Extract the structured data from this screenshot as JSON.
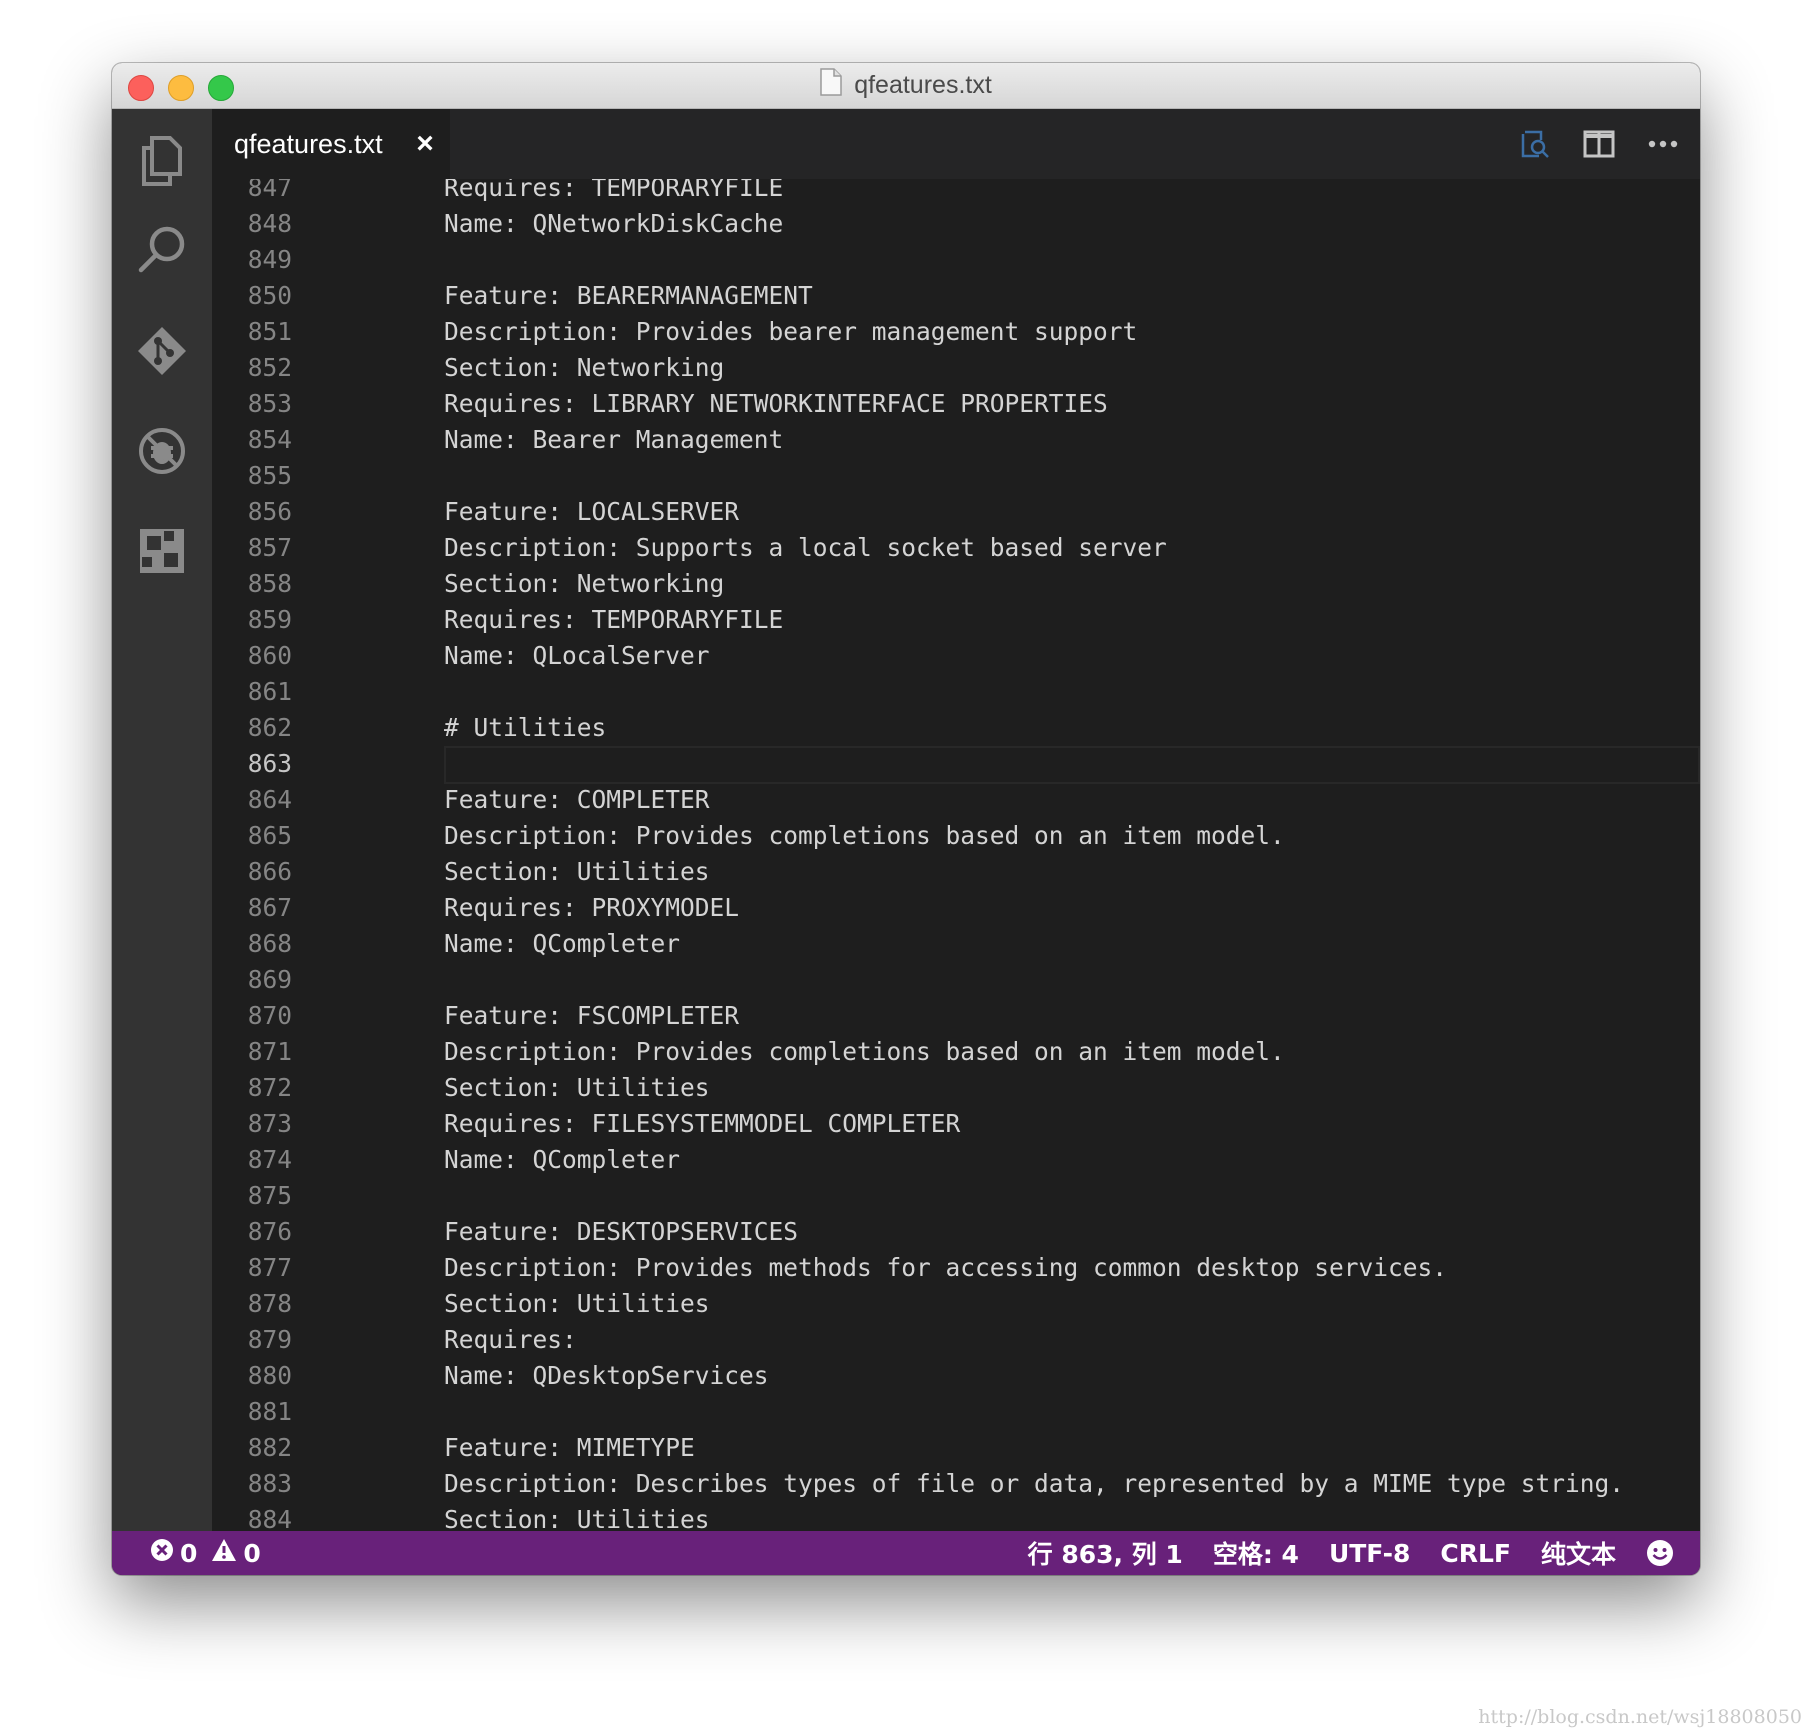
{
  "window": {
    "title": "qfeatures.txt"
  },
  "activity_bar": {
    "items": [
      "explorer-icon",
      "search-icon",
      "source-control-icon",
      "debug-icon",
      "extensions-icon"
    ]
  },
  "tabs": [
    {
      "label": "qfeatures.txt",
      "close_glyph": "×"
    }
  ],
  "editor": {
    "current_line": 863,
    "lines": [
      {
        "n": "847",
        "text": "Requires: TEMPORARYFILE"
      },
      {
        "n": "848",
        "text": "Name: QNetworkDiskCache"
      },
      {
        "n": "849",
        "text": ""
      },
      {
        "n": "850",
        "text": "Feature: BEARERMANAGEMENT"
      },
      {
        "n": "851",
        "text": "Description: Provides bearer management support"
      },
      {
        "n": "852",
        "text": "Section: Networking"
      },
      {
        "n": "853",
        "text": "Requires: LIBRARY NETWORKINTERFACE PROPERTIES"
      },
      {
        "n": "854",
        "text": "Name: Bearer Management"
      },
      {
        "n": "855",
        "text": ""
      },
      {
        "n": "856",
        "text": "Feature: LOCALSERVER"
      },
      {
        "n": "857",
        "text": "Description: Supports a local socket based server"
      },
      {
        "n": "858",
        "text": "Section: Networking"
      },
      {
        "n": "859",
        "text": "Requires: TEMPORARYFILE"
      },
      {
        "n": "860",
        "text": "Name: QLocalServer"
      },
      {
        "n": "861",
        "text": ""
      },
      {
        "n": "862",
        "text": "# Utilities"
      },
      {
        "n": "863",
        "text": ""
      },
      {
        "n": "864",
        "text": "Feature: COMPLETER"
      },
      {
        "n": "865",
        "text": "Description: Provides completions based on an item model."
      },
      {
        "n": "866",
        "text": "Section: Utilities"
      },
      {
        "n": "867",
        "text": "Requires: PROXYMODEL"
      },
      {
        "n": "868",
        "text": "Name: QCompleter"
      },
      {
        "n": "869",
        "text": ""
      },
      {
        "n": "870",
        "text": "Feature: FSCOMPLETER"
      },
      {
        "n": "871",
        "text": "Description: Provides completions based on an item model."
      },
      {
        "n": "872",
        "text": "Section: Utilities"
      },
      {
        "n": "873",
        "text": "Requires: FILESYSTEMMODEL COMPLETER"
      },
      {
        "n": "874",
        "text": "Name: QCompleter"
      },
      {
        "n": "875",
        "text": ""
      },
      {
        "n": "876",
        "text": "Feature: DESKTOPSERVICES"
      },
      {
        "n": "877",
        "text": "Description: Provides methods for accessing common desktop services."
      },
      {
        "n": "878",
        "text": "Section: Utilities"
      },
      {
        "n": "879",
        "text": "Requires:"
      },
      {
        "n": "880",
        "text": "Name: QDesktopServices"
      },
      {
        "n": "881",
        "text": ""
      },
      {
        "n": "882",
        "text": "Feature: MIMETYPE"
      },
      {
        "n": "883",
        "text": "Description: Describes types of file or data, represented by a MIME type string."
      },
      {
        "n": "884",
        "text": "Section: Utilities"
      }
    ]
  },
  "statusbar": {
    "errors": "0",
    "warnings": "0",
    "position": "行 863, 列 1",
    "indent": "空格: 4",
    "encoding": "UTF-8",
    "eol": "CRLF",
    "language": "纯文本",
    "feedback_icon": "smiley-icon"
  },
  "watermark": "http://blog.csdn.net/wsj18808050",
  "colors": {
    "statusbar": "#68217a",
    "editor_bg": "#1e1e1e",
    "activity_bg": "#333333"
  }
}
